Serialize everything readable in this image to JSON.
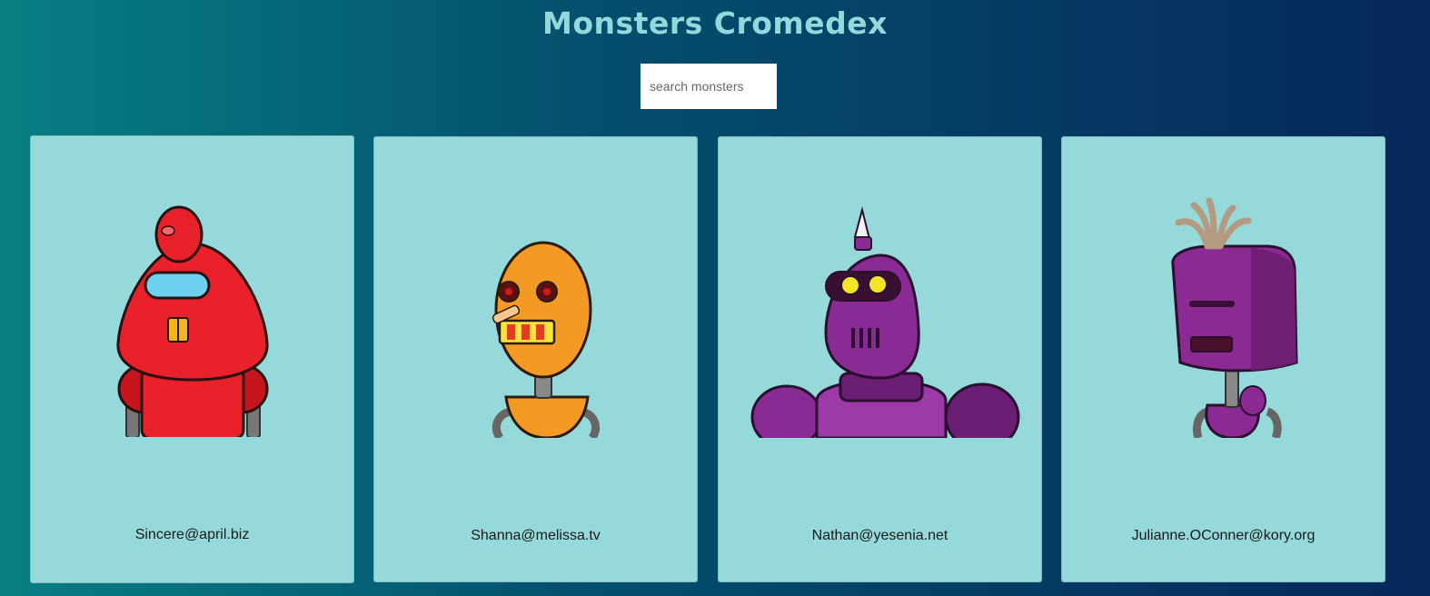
{
  "header": {
    "title": "Monsters Cromedex"
  },
  "search": {
    "placeholder": "search monsters",
    "value": ""
  },
  "monsters": [
    {
      "email": "Sincere@april.biz",
      "color": "#e8212b",
      "robot": "red-robot"
    },
    {
      "email": "Shanna@melissa.tv",
      "color": "#f39a24",
      "robot": "orange-robot"
    },
    {
      "email": "Nathan@yesenia.net",
      "color": "#8a2a94",
      "robot": "purple-horn-robot"
    },
    {
      "email": "Julianne.OConner@kory.org",
      "color": "#8c2a93",
      "robot": "purple-bucket-robot"
    }
  ]
}
